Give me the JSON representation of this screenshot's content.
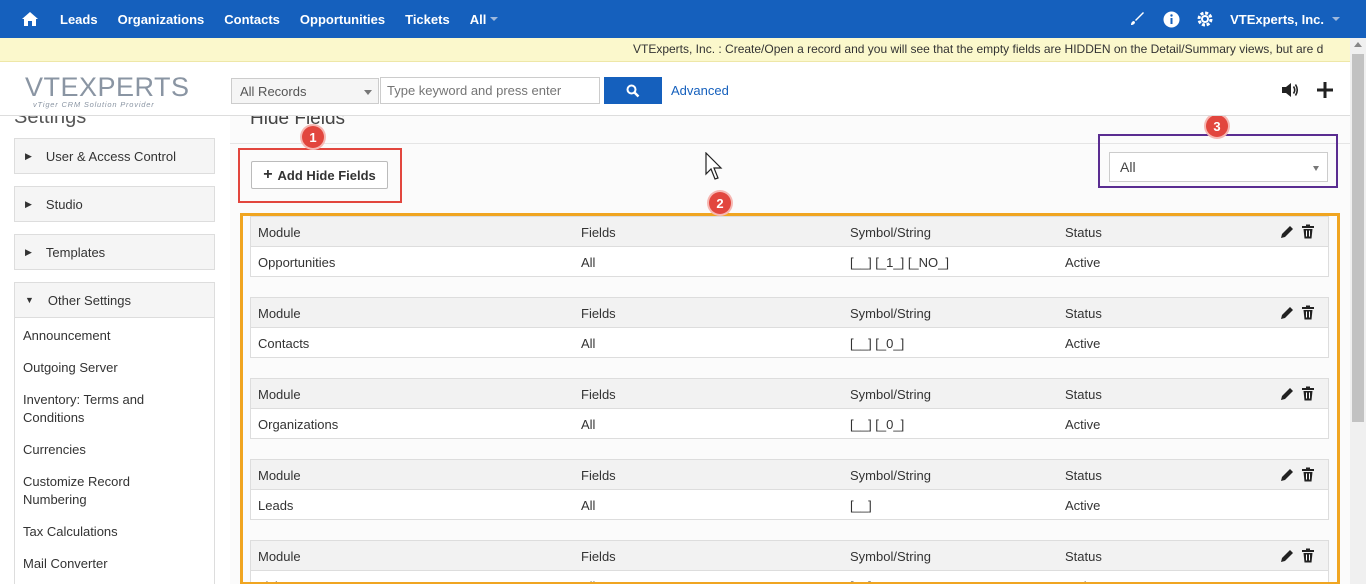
{
  "topnav": {
    "items": [
      "Leads",
      "Organizations",
      "Contacts",
      "Opportunities",
      "Tickets",
      "All"
    ],
    "account": "VTExperts, Inc."
  },
  "announcement": "VTExperts, Inc. : Create/Open a record and you will see that the empty fields are HIDDEN on the Detail/Summary views, but are d",
  "header": {
    "logo_text": "VTEXPERTS",
    "logo_tagline": "vTiger CRM Solution Provider",
    "records_select": "All Records",
    "search_placeholder": "Type keyword and press enter",
    "advanced_label": "Advanced"
  },
  "sidebar": {
    "title": "Settings",
    "sections": [
      "User & Access Control",
      "Studio",
      "Templates",
      "Other Settings"
    ],
    "other_items": [
      "Announcement",
      "Outgoing Server",
      "Inventory: Terms and Conditions",
      "Currencies",
      "Customize Record Numbering",
      "Tax Calculations",
      "Mail Converter"
    ]
  },
  "main": {
    "title": "Hide Fields",
    "add_button": "Add Hide Fields",
    "filter_value": "All",
    "badges": [
      "1",
      "2",
      "3"
    ],
    "columns": [
      "Module",
      "Fields",
      "Symbol/String",
      "Status"
    ],
    "rules": [
      {
        "module": "Opportunities",
        "fields": "All",
        "symbol": "[__] [_1_] [_NO_]",
        "status": "Active"
      },
      {
        "module": "Contacts",
        "fields": "All",
        "symbol": "[__] [_0_]",
        "status": "Active"
      },
      {
        "module": "Organizations",
        "fields": "All",
        "symbol": "[__] [_0_]",
        "status": "Active"
      },
      {
        "module": "Leads",
        "fields": "All",
        "symbol": "[__]",
        "status": "Active"
      },
      {
        "module": "Tickets",
        "fields": "All",
        "symbol": "[__]",
        "status": "Active"
      }
    ]
  },
  "colors": {
    "nav_blue": "#1560bd",
    "announce_bg": "#fbf8cc",
    "highlight_red": "#e2463e",
    "highlight_purple": "#5a2d91",
    "highlight_orange": "#f0a521"
  }
}
